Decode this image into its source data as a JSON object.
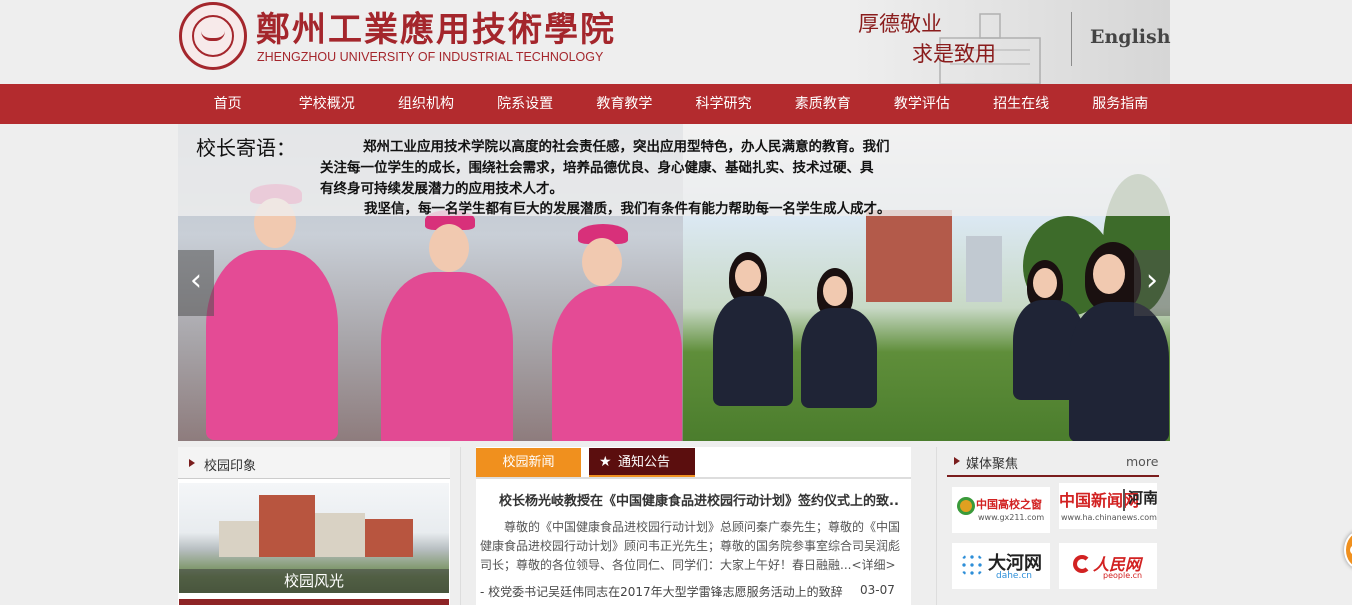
{
  "header": {
    "school_name_cn": "鄭州工業應用技術學院",
    "school_name_en": "ZHENGZHOU UNIVERSITY OF INDUSTRIAL TECHNOLOGY",
    "motto_line1": "厚德敬业",
    "motto_line2": "求是致用",
    "english_link": "English",
    "brand_color": "#a4262c"
  },
  "nav": {
    "color": "#b32b2e",
    "items": [
      "首页",
      "学校概况",
      "组织机构",
      "院系设置",
      "教育教学",
      "科学研究",
      "素质教育",
      "教学评估",
      "招生在线",
      "服务指南"
    ]
  },
  "banner": {
    "title": "校长寄语：",
    "lines": [
      "郑州工业应用技术学院以高度的社会责任感，突出应用型特色，办人民满意的教育。我们",
      "关注每一位学生的成长，围绕社会需求，培养品德优良、身心健康、基础扎实、技术过硬、具",
      "有终身可持续发展潜力的应用技术人才。",
      "我坚信，每一名学生都有巨大的发展潜质，我们有条件有能力帮助每一名学生成人成才。"
    ],
    "prev_icon": "chevron-left-icon",
    "next_icon": "chevron-right-icon",
    "prev_glyph": "‹",
    "next_glyph": "›"
  },
  "campus": {
    "title": "校园印象",
    "caption": "校园风光"
  },
  "news": {
    "tab_news": "校园新闻",
    "tab_notice": "通知公告",
    "notice_icon": "star-icon",
    "notice_glyph": "★",
    "headline": "校长杨光岐教授在《中国健康食品进校园行动计划》签约仪式上的致..",
    "paragraph_lines": [
      "　　尊敬的《中国健康食品进校园行动计划》总顾问秦广泰先生；尊敬的《中国",
      "健康食品进校园行动计划》顾问韦正光先生；尊敬的国务院参事室综合司吴润彪",
      "司长；尊敬的各位领导、各位同仁、同学们：大家上午好！春日融融...<详细>"
    ],
    "items": [
      {
        "title": "- 校党委书记吴廷伟同志在2017年大型学雷锋志愿服务活动上的致辞",
        "date": "03-07"
      }
    ],
    "accent_color": "#f0901e",
    "notice_color": "#5b0e0e"
  },
  "media": {
    "title": "媒体聚焦",
    "more": "more",
    "logos": [
      {
        "name": "中国高校之窗",
        "sub": "www.gx211.com"
      },
      {
        "name": "中国新闻网",
        "region": "河南",
        "sub": "www.ha.chinanews.com"
      },
      {
        "name": "大河网",
        "sub": "dahe.cn"
      },
      {
        "name": "人民网",
        "sub": "people.cn"
      }
    ]
  }
}
